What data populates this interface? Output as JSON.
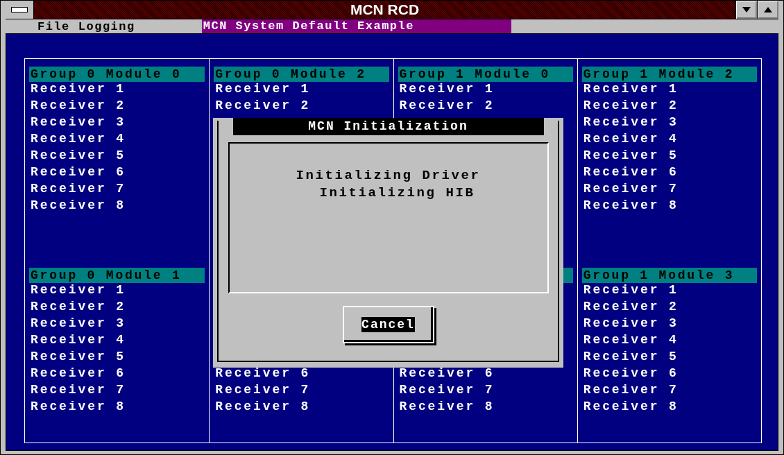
{
  "window": {
    "title": "MCN RCD"
  },
  "menu": [
    {
      "label": "File"
    },
    {
      "label": "Logging"
    }
  ],
  "document_title": "MCN System Default Example",
  "columns": [
    {
      "modules": [
        {
          "heading": "Group 0 Module 0",
          "receivers": [
            "Receiver 1",
            "Receiver 2",
            "Receiver 3",
            "Receiver 4",
            "Receiver 5",
            "Receiver 6",
            "Receiver 7",
            "Receiver 8"
          ]
        },
        {
          "heading": "Group 0 Module 1",
          "receivers": [
            "Receiver 1",
            "Receiver 2",
            "Receiver 3",
            "Receiver 4",
            "Receiver 5",
            "Receiver 6",
            "Receiver 7",
            "Receiver 8"
          ]
        }
      ]
    },
    {
      "modules": [
        {
          "heading": "Group 0 Module 2",
          "receivers": [
            "Receiver 1",
            "Receiver 2"
          ]
        },
        {
          "receivers": [
            "Receiver 6",
            "Receiver 7",
            "Receiver 8"
          ]
        }
      ]
    },
    {
      "modules": [
        {
          "heading": "Group 1 Module 0",
          "receivers": [
            "Receiver 1",
            "Receiver 2"
          ]
        },
        {
          "heading_bar": true,
          "receivers": [
            "Receiver 6",
            "Receiver 7",
            "Receiver 8"
          ]
        }
      ]
    },
    {
      "modules": [
        {
          "heading": "Group 1 Module 2",
          "receivers": [
            "Receiver 1",
            "Receiver 2",
            "Receiver 3",
            "Receiver 4",
            "Receiver 5",
            "Receiver 6",
            "Receiver 7",
            "Receiver 8"
          ]
        },
        {
          "heading": "Group 1 Module 3",
          "receivers": [
            "Receiver 1",
            "Receiver 2",
            "Receiver 3",
            "Receiver 4",
            "Receiver 5",
            "Receiver 6",
            "Receiver 7",
            "Receiver 8"
          ]
        }
      ]
    }
  ],
  "dialog": {
    "title": "MCN Initialization",
    "messages": [
      "Initializing Driver",
      "Initializing HIB"
    ],
    "buttons": [
      {
        "label": "Cancel",
        "focused": true
      }
    ]
  }
}
